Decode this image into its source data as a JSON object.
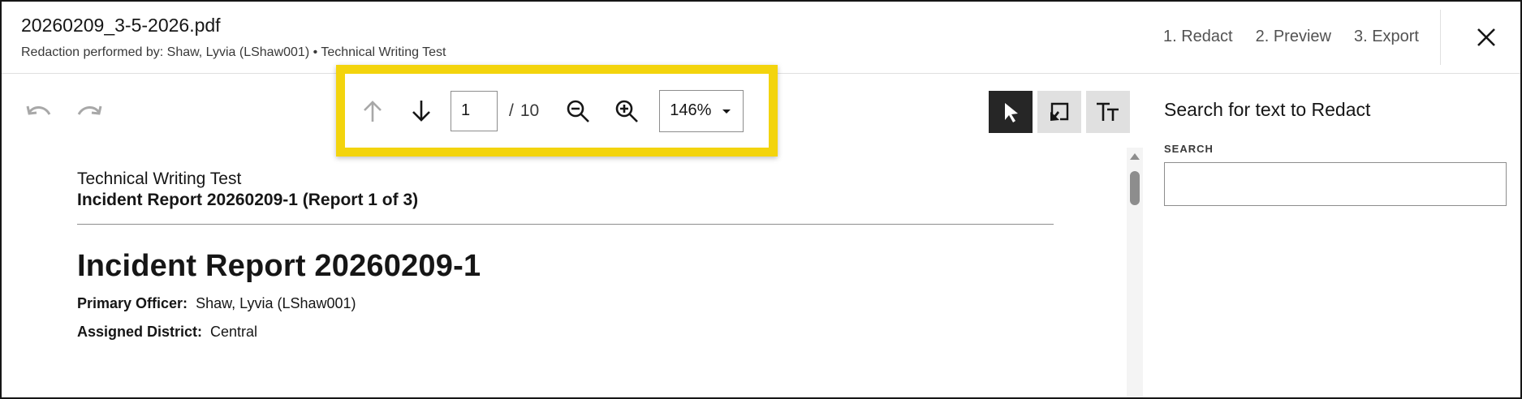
{
  "header": {
    "file_name": "20260209_3-5-2026.pdf",
    "subtitle": "Redaction performed by: Shaw, Lyvia (LShaw001) • Technical Writing Test",
    "steps": [
      {
        "label": "1.  Redact"
      },
      {
        "label": "2.  Preview"
      },
      {
        "label": "3.  Export"
      }
    ],
    "close_icon": "close-icon"
  },
  "toolbar": {
    "undo_icon": "undo-icon",
    "redo_icon": "redo-icon",
    "page_current": "1",
    "page_separator": "/",
    "page_total": "10",
    "zoom_value": "146%",
    "highlight_color": "#f3d40d",
    "tools": [
      {
        "name": "select-arrow-icon",
        "active": true
      },
      {
        "name": "area-redact-icon",
        "active": false
      },
      {
        "name": "text-redact-icon",
        "active": false
      }
    ]
  },
  "document": {
    "header_line_1": "Technical Writing Test",
    "header_line_2": "Incident Report 20260209-1 (Report 1 of 3)",
    "title": "Incident Report 20260209-1",
    "fields": [
      {
        "label": "Primary Officer:",
        "value": "Shaw, Lyvia (LShaw001)"
      },
      {
        "label": "Assigned District:",
        "value": "Central"
      }
    ]
  },
  "panel": {
    "title": "Search for text to Redact",
    "search_label": "SEARCH",
    "search_value": ""
  }
}
